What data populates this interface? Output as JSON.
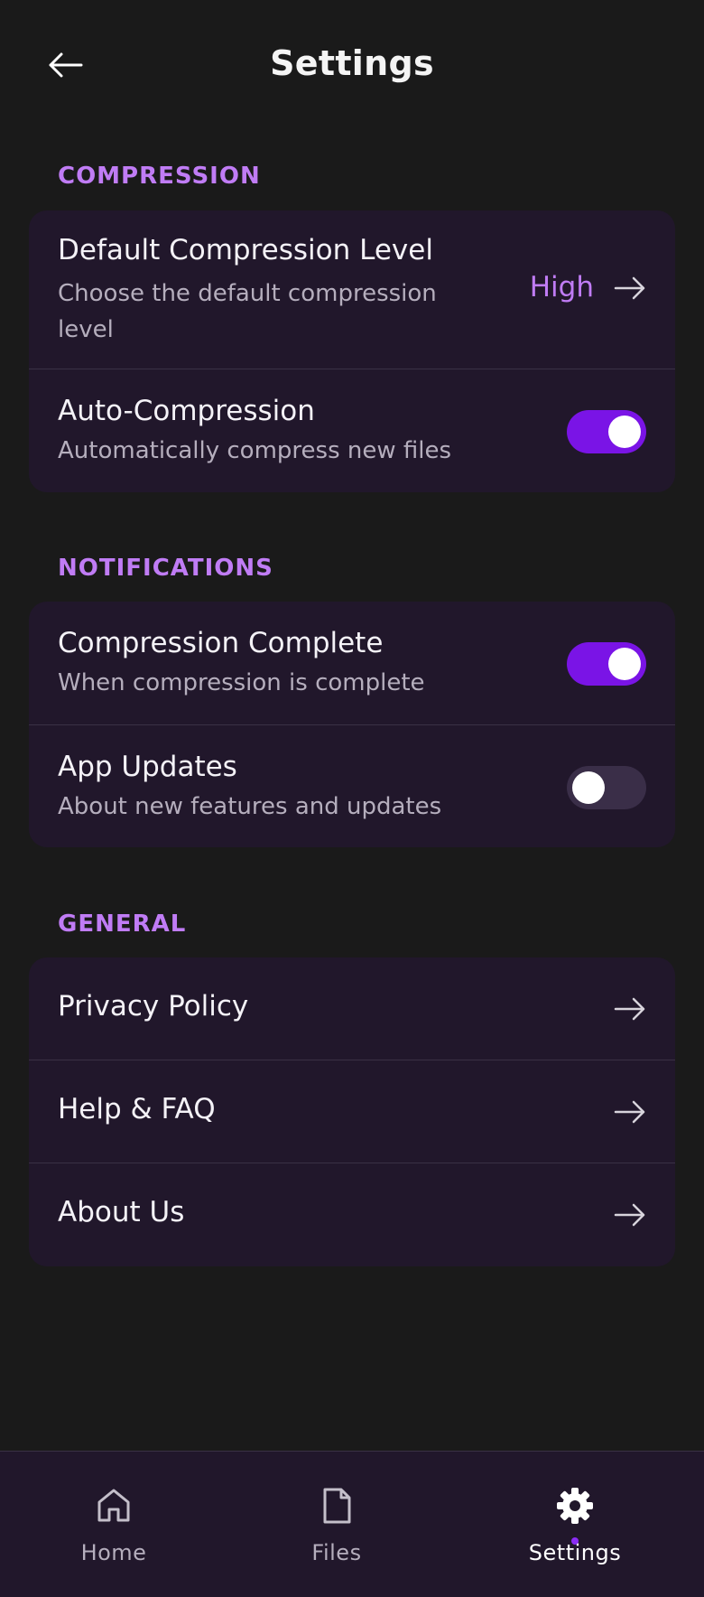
{
  "header": {
    "title": "Settings",
    "back_icon": "arrow-left-icon"
  },
  "sections": {
    "compression": {
      "title": "COMPRESSION",
      "default_level": {
        "title": "Default Compression Level",
        "subtitle_line1": "Choose the default compression",
        "subtitle_line2": "level",
        "value": "High"
      },
      "auto": {
        "title": "Auto-Compression",
        "subtitle": "Automatically compress new files",
        "enabled": true
      }
    },
    "notifications": {
      "title": "NOTIFICATIONS",
      "complete": {
        "title": "Compression Complete",
        "subtitle": "When compression is complete",
        "enabled": true
      },
      "updates": {
        "title": "App Updates",
        "subtitle": "About new features and updates",
        "enabled": false
      }
    },
    "general": {
      "title": "GENERAL",
      "items": [
        {
          "label": "Privacy Policy"
        },
        {
          "label": "Help & FAQ"
        },
        {
          "label": "About Us"
        }
      ]
    }
  },
  "bottom_nav": {
    "items": [
      {
        "label": "Home",
        "icon": "home-icon",
        "active": false
      },
      {
        "label": "Files",
        "icon": "file-icon",
        "active": false
      },
      {
        "label": "Settings",
        "icon": "gear-icon",
        "active": true
      }
    ]
  },
  "colors": {
    "background": "#1a1a1a",
    "card": "#21172b",
    "accent": "#c07cf5",
    "toggle_on": "#7a14e6",
    "toggle_off": "#3a2e48"
  }
}
